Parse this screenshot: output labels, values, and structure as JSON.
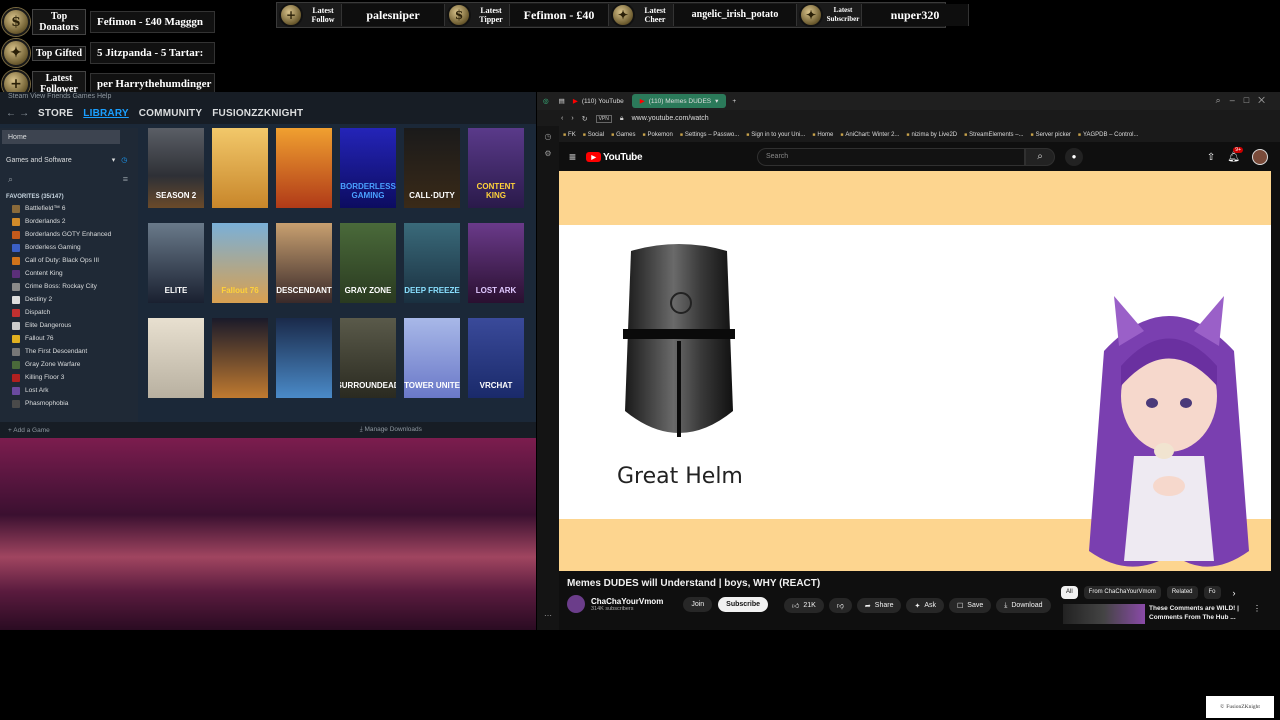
{
  "overlay_left": [
    {
      "label": "Top Donators",
      "value": "Fefimon - £40   Magggn"
    },
    {
      "label": "Top Gifted",
      "value": "5   Jitzpanda - 5   Tartar:"
    },
    {
      "label": "Latest Follower",
      "value": "per   Harrythehumdinger"
    }
  ],
  "overlay_top": [
    {
      "label": "Latest Follow",
      "value": "palesniper"
    },
    {
      "label": "Latest Tipper",
      "value": "Fefimon - £40"
    },
    {
      "label": "Latest Cheer",
      "value": "angelic_irish_potato"
    },
    {
      "label": "Latest Subscriber",
      "value": "nuper320"
    }
  ],
  "steam": {
    "menu": "Steam  View  Friends  Games  Help",
    "nav": {
      "store": "STORE",
      "library": "LIBRARY",
      "community": "COMMUNITY",
      "user": "FUSIONZZKNIGHT"
    },
    "home": "Home",
    "filter": "Games and Software",
    "favorites_label": "FAVORITES (35/147)",
    "games": [
      {
        "name": "Battlefield™ 6",
        "color": "#8a6a3a"
      },
      {
        "name": "Borderlands 2",
        "color": "#d18b2a"
      },
      {
        "name": "Borderlands GOTY Enhanced",
        "color": "#c45a1c"
      },
      {
        "name": "Borderless Gaming",
        "color": "#3b5fc4"
      },
      {
        "name": "Call of Duty: Black Ops III",
        "color": "#d0731a"
      },
      {
        "name": "Content King",
        "color": "#5b2f7a"
      },
      {
        "name": "Crime Boss: Rockay City",
        "color": "#8a8a8a"
      },
      {
        "name": "Destiny 2",
        "color": "#dddddd"
      },
      {
        "name": "Dispatch",
        "color": "#c03030"
      },
      {
        "name": "Elite Dangerous",
        "color": "#cccccc"
      },
      {
        "name": "Fallout 76",
        "color": "#e0b020"
      },
      {
        "name": "The First Descendant",
        "color": "#777777"
      },
      {
        "name": "Gray Zone Warfare",
        "color": "#4a6a3a"
      },
      {
        "name": "Killing Floor 3",
        "color": "#b02020"
      },
      {
        "name": "Lost Ark",
        "color": "#6a4aa0"
      },
      {
        "name": "Phasmophobia",
        "color": "#4a4a4a"
      }
    ],
    "tiles": [
      {
        "title": "SEASON 2",
        "bg": "linear-gradient(180deg,#5a5e66,#2e3036 60%,#6a4a2a)",
        "fg": "#ffffff"
      },
      {
        "title": "",
        "bg": "linear-gradient(180deg,#f2c86a,#c8862a)",
        "fg": "#3a2010"
      },
      {
        "title": "",
        "bg": "linear-gradient(180deg,#f0a030,#b03a18)",
        "fg": "#ffffff"
      },
      {
        "title": "BORDERLESS GAMING",
        "bg": "linear-gradient(180deg,#2424b8,#0c0c60)",
        "fg": "#4aa0ff"
      },
      {
        "title": "CALL·DUTY",
        "bg": "linear-gradient(180deg,#1a1a1a,#3a2a18)",
        "fg": "#ffffff"
      },
      {
        "title": "CONTENT KING",
        "bg": "linear-gradient(180deg,#5a3a8a,#2a1a4a)",
        "fg": "#ffd23a"
      },
      {
        "title": "ELITE",
        "bg": "linear-gradient(180deg,#6a7a8a,#1a2030)",
        "fg": "#ffffff"
      },
      {
        "title": "Fallout 76",
        "bg": "linear-gradient(180deg,#7ab0d8,#d8a050)",
        "fg": "#ffd23a"
      },
      {
        "title": "DESCENDANT",
        "bg": "linear-gradient(180deg,#c8a070,#3a2a2a)",
        "fg": "#ffffff"
      },
      {
        "title": "GRAY ZONE",
        "bg": "linear-gradient(180deg,#4a6a3a,#2a3a20)",
        "fg": "#ffffff"
      },
      {
        "title": "DEEP FREEZE",
        "bg": "linear-gradient(180deg,#3a6a7a,#1a3040)",
        "fg": "#8ae0ff"
      },
      {
        "title": "LOST ARK",
        "bg": "linear-gradient(180deg,#6a3a8a,#2a1030)",
        "fg": "#e0c8ff"
      },
      {
        "title": "",
        "bg": "linear-gradient(180deg,#e8e0d0,#b8b0a0)",
        "fg": "#6a5a40"
      },
      {
        "title": "",
        "bg": "linear-gradient(180deg,#1a1a2a,#c07a30)",
        "fg": "#ffffff"
      },
      {
        "title": "",
        "bg": "linear-gradient(180deg,#1a2a4a,#4a8ac8)",
        "fg": "#ffffff"
      },
      {
        "title": "SURROUNDEAD",
        "bg": "linear-gradient(180deg,#5a5a4a,#2a2a20)",
        "fg": "#ffffff"
      },
      {
        "title": "TOWER UNITE",
        "bg": "linear-gradient(180deg,#a8b8e8,#6a78c8)",
        "fg": "#ffffff"
      },
      {
        "title": "VRCHAT",
        "bg": "linear-gradient(180deg,#3a4a9a,#1a2a6a)",
        "fg": "#ffffff"
      }
    ],
    "add_game": "Add a Game",
    "manage_downloads": "Manage Downloads"
  },
  "browser": {
    "tabs": [
      "(110) YouTube",
      "(110) Memes DUDES"
    ],
    "url": "www.youtube.com/watch",
    "bookmarks": [
      "FK",
      "Social",
      "Games",
      "Pokemon",
      "Settings – Passwo...",
      "Sign in to your Uni...",
      "Home",
      "AniChart: Winter 2...",
      "nizima by Live2D",
      "StreamElements –...",
      "Server picker",
      "YAGPDB – Control..."
    ],
    "yt_logo": "YouTube",
    "search_placeholder": "Search",
    "notif_count": "9+",
    "video": {
      "label": "Great Helm"
    },
    "title": "Memes DUDES will Understand | boys, WHY (REACT)",
    "channel": "ChaChaYourVmom",
    "subscribers": "314K subscribers",
    "join": "Join",
    "subscribe": "Subscribe",
    "likes": "21K",
    "share": "Share",
    "ask": "Ask",
    "save": "Save",
    "download": "Download",
    "chips": [
      "All",
      "From ChaChaYourVmom",
      "Related",
      "Fo"
    ],
    "rec_title": "These Comments are WILD! | Comments From The Hub ..."
  },
  "watermark": "FusionZKnight"
}
